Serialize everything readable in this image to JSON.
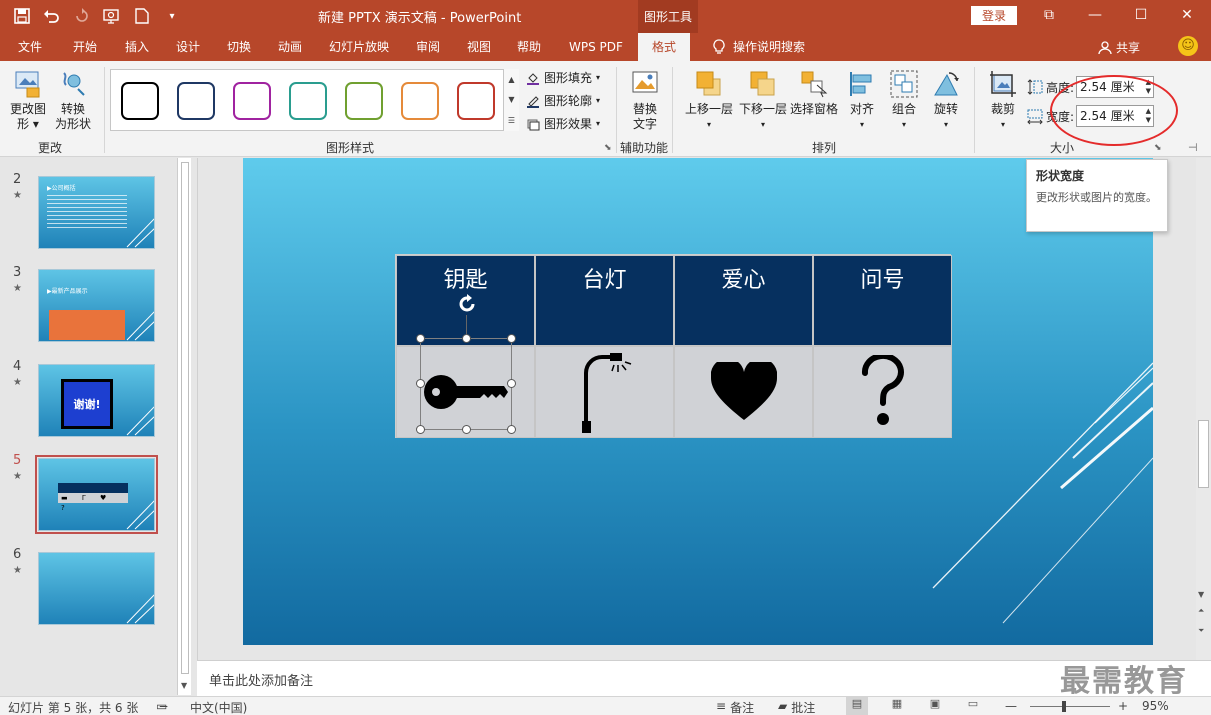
{
  "titlebar": {
    "doc_title": "新建 PPTX 演示文稿  -  PowerPoint",
    "tools_tab": "图形工具",
    "login": "登录",
    "qat": [
      "save-icon",
      "undo-icon",
      "redo-icon",
      "present-from-start-icon",
      "new-file-icon",
      "customize-icon"
    ],
    "ctrl": {
      "ribbon_opts": "⧉",
      "min": "—",
      "max": "☐",
      "close": "✕"
    }
  },
  "menu": {
    "tabs": [
      "文件",
      "开始",
      "插入",
      "设计",
      "切换",
      "动画",
      "幻灯片放映",
      "审阅",
      "视图",
      "帮助",
      "WPS PDF",
      "格式"
    ],
    "active": "格式",
    "search": "操作说明搜索",
    "share": "共享"
  },
  "ribbon": {
    "change_group": {
      "label": "更改",
      "edit_shape": "更改图\n形 ▾",
      "convert": "转换\n为形状"
    },
    "styles_group": {
      "label": "图形样式",
      "swatch_colors": [
        "#000000",
        "#1f3864",
        "#a023a0",
        "#2a9d8f",
        "#70a030",
        "#e58a3a",
        "#c0392b"
      ],
      "fill": "图形填充",
      "outline": "图形轮廓",
      "effect": "图形效果"
    },
    "a11y_group": {
      "label": "辅助功能",
      "alt_text": "替换\n文字"
    },
    "arrange_group": {
      "label": "排列",
      "bring_forward": "上移一层",
      "send_backward": "下移一层",
      "selection_pane": "选择窗格",
      "align": "对齐",
      "group": "组合",
      "rotate": "旋转"
    },
    "size_group": {
      "label": "大小",
      "crop": "裁剪",
      "height_label": "高度:",
      "height_value": "2.54 厘米",
      "width_label": "宽度:",
      "width_value": "2.54 厘米"
    }
  },
  "tooltip": {
    "title": "形状宽度",
    "desc": "更改形状或图片的宽度。"
  },
  "thumbnails": [
    {
      "num": "2",
      "title": "▶公司概括"
    },
    {
      "num": "3",
      "title": "▶最新产品展示"
    },
    {
      "num": "4",
      "title": "谢谢!"
    },
    {
      "num": "5",
      "title": ""
    },
    {
      "num": "6",
      "title": ""
    }
  ],
  "thumbnail_star": "★",
  "slide": {
    "headers": [
      "钥匙",
      "台灯",
      "爱心",
      "问号"
    ],
    "icons": [
      "key-icon",
      "desk-lamp-icon",
      "heart-icon",
      "question-mark-icon"
    ],
    "question": "?"
  },
  "notes_placeholder": "单击此处添加备注",
  "watermark": "最需教育",
  "status": {
    "slide_info": "幻灯片 第 5 张，共 6 张",
    "language": "中文(中国)",
    "notes": "备注",
    "comments": "批注",
    "zoom": "95%"
  }
}
